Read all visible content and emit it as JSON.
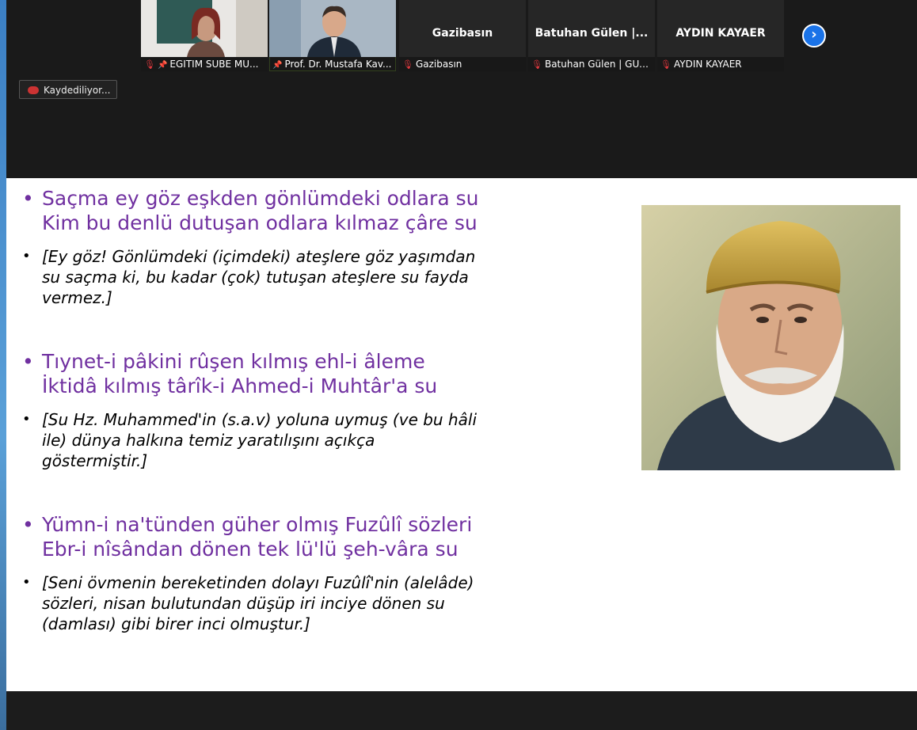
{
  "participants": [
    {
      "label": "EGITIM SUBE MU...",
      "has_video": true,
      "pinned": true,
      "muted": true
    },
    {
      "label": "Prof. Dr. Mustafa Kav...",
      "has_video": true,
      "pinned": true,
      "muted": false,
      "active": true
    },
    {
      "label": "Gazibasın",
      "display_name": "Gazibasın",
      "has_video": false,
      "muted": true
    },
    {
      "label": "Batuhan Gülen | GUZE...",
      "display_name": "Batuhan Gülen |...",
      "has_video": false,
      "muted": true
    },
    {
      "label": "AYDIN KAYAER",
      "display_name": "AYDIN KAYAER",
      "has_video": false,
      "muted": true
    }
  ],
  "recording": {
    "label": "Kaydediliyor..."
  },
  "slide": {
    "verses": [
      {
        "line1": "Saçma ey göz eşkden gönlümdeki odlara su",
        "line2": "Kim bu denlü dutuşan odlara kılmaz çâre su"
      },
      {
        "line1": "Tıynet-i pâkini rûşen kılmış ehl-i âleme",
        "line2": "İktidâ kılmış târîk-i Ahmed-i Muhtâr'a su"
      },
      {
        "line1": "Yümn-i na'tünden güher olmış Fuzûlî sözleri",
        "line2": "Ebr-i nîsândan dönen tek lü'lü şeh-vâra su"
      }
    ],
    "translations": [
      {
        "l1": "[Ey göz! Gönlümdeki (içimdeki) ateşlere göz yaşımdan",
        "l2": "su saçma ki, bu kadar (çok) tutuşan ateşlere su fayda",
        "l3": "vermez.]"
      },
      {
        "l1": "[Su Hz. Muhammed'in (s.a.v) yoluna uymuş (ve bu hâli",
        "l2": "ile) dünya halkına temiz yaratılışını açıkça",
        "l3": "göstermiştir.]"
      },
      {
        "l1": "[Seni övmenin bereketinden dolayı Fuzûlî'nin (alelâde)",
        "l2": "sözleri, nisan bulutundan düşüp iri inciye dönen su",
        "l3": "(damlası) gibi birer inci olmuştur.]"
      }
    ]
  },
  "colors": {
    "verse": "#7030a0",
    "accent": "#1a73e8",
    "active_border": "#8cc63f",
    "muted": "#e0383e"
  }
}
